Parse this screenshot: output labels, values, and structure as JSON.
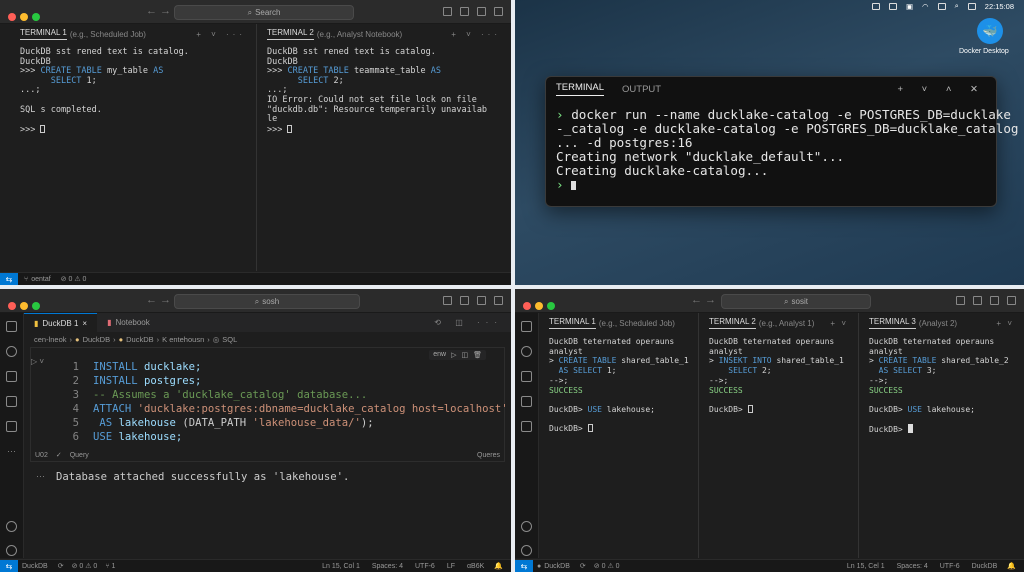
{
  "q1": {
    "search": "Search",
    "pane1": {
      "title": "TERMINAL 1",
      "subtitle": "(e.g., Scheduled Job)",
      "actions": "+ ˅ ···",
      "lines": [
        "DuckDB sst rened text is catalog.",
        "DuckDB"
      ],
      "prompt": ">>> ",
      "kw1": "CREATE TABLE",
      "tbl": " my_table ",
      "kw2": "AS",
      "indent": "      ",
      "kw3": "SELECT",
      "val": " 1;",
      "cont": "...;",
      "done": "SQL s completed.",
      "prompt2": ">>> "
    },
    "pane2": {
      "title": "TERMINAL 2",
      "subtitle": "(e.g., Analyst Notebook)",
      "actions": "+ ˅ ···",
      "lines": [
        "DuckDB sst rened text is catalog.",
        "DuckDB"
      ],
      "prompt": ">>> ",
      "kw1": "CREATE TABLE",
      "tbl": " teammate_table ",
      "kw2": "AS",
      "indent": "      ",
      "kw3": "SELECT",
      "val": " 2;",
      "cont": "...;",
      "err1": "IO Error: Could not set file lock on file",
      "err2": "\"duckdb.db\": Resource temperarily unavailab",
      "err3": "le",
      "prompt2": ">>> "
    },
    "status": {
      "branch": "oentaf",
      "problems": "⊘ 0 ⚠ 0"
    }
  },
  "q2": {
    "clock": "22:15:08",
    "app_label": "Docker Desktop",
    "tab_terminal": "TERMINAL",
    "tab_output": "OUTPUT",
    "actions": "+ ˅ ˄ ✕",
    "prompt": "›",
    "cmd1": "docker run --name ducklake-catalog -e POSTGRES_DB=ducklake",
    "cmd2": "-_catalog -e ducklake-catalog -e POSTGRES_DB=ducklake_catalog",
    "cmd3": "... -d postgres:16",
    "out1": "Creating network \"ducklake_default\"...",
    "out2": "Creating ducklake-catalog..."
  },
  "q3": {
    "search": "sosh",
    "tab_active": "DuckDB 1",
    "tab_other": "Notebook",
    "breadcrumb": [
      "cen-lneok",
      "DuckDB",
      "DuckDB",
      "K entehousn",
      "SQL"
    ],
    "cell_run": "enw",
    "code": {
      "l1a": "INSTALL",
      "l1b": " ducklake;",
      "l2a": "INSTALL",
      "l2b": " postgres;",
      "l3": "-- Assumes a 'ducklake_catalog' database...",
      "l4a": "ATTACH",
      "l4b": " 'ducklake:postgres:dbname=ducklake_catalog host=localhost'",
      "l5a": " AS",
      "l5b": " lakehouse ",
      "l5c": "(DATA_PATH ",
      "l5d": "'lakehouse_data/'",
      "l5e": ");",
      "l6a": "USE",
      "l6b": " lakehouse;"
    },
    "line_numbers": [
      "1",
      "2",
      "3",
      "4",
      "5",
      "6"
    ],
    "cell_footer_left": "U02",
    "cell_footer_query": "Query",
    "cell_footer_right": "Queres",
    "output_dots": "···",
    "output": "Database attached successfully as 'lakehouse'.",
    "status": {
      "branch": "DuckDB",
      "problems": "⊘ 0 ⚠ 0",
      "ports": "⑂ 1",
      "ln": "Ln 15, Col 1",
      "spaces": "Spaces: 4",
      "enc": "UTF-6",
      "eol": "LF",
      "lang": "αB6K"
    }
  },
  "q4": {
    "search": "sosit",
    "panes": [
      {
        "title": "TERMINAL 1",
        "subtitle": "(e.g., Scheduled Job)",
        "h1": "DuckDB teternated operauns",
        "h2": "analyst",
        "kw": "CREATE TABLE",
        "tbl": " shared_table_1",
        "as": "AS",
        "sel": "SELECT",
        "val": " 1;",
        "cont": "-->;",
        "ok": "SUCCESS",
        "p1": "DuckDB> ",
        "use": "USE",
        "uset": " lakehouse;",
        "p2": "DuckDB> "
      },
      {
        "title": "TERMINAL 2",
        "subtitle": "(e.g., Analyst 1)",
        "h1": "DuckDB teternated operauns",
        "h2": "analyst",
        "kw": "INSEKT INTO",
        "tbl": " shared_table_1",
        "as": "",
        "sel": "SELECT",
        "val": " 2;",
        "cont": "-->;",
        "ok": "SUCCESS",
        "p1": "DuckDB> ",
        "use": "",
        "uset": "",
        "p2": ""
      },
      {
        "title": "TERMINAL 3",
        "subtitle": "(Analyst 2)",
        "h1": "DuckDB teternated operauns",
        "h2": "analyst",
        "kw": "CREATE TABLE",
        "tbl": " shared_table_2",
        "as": "AS",
        "sel": "SELECT",
        "val": " 3;",
        "cont": "-->;",
        "ok": "SUCCESS",
        "p1": "DuckDB> ",
        "use": "USE",
        "uset": " lakehouse;",
        "p2": "DuckDB> "
      }
    ],
    "status": {
      "branch": "DuckDB",
      "problems": "⊘ 0 ⚠ 0",
      "ln": "Ln 15, Cel 1",
      "spaces": "Spaces: 4",
      "enc": "UTF-6",
      "lang": "DuckDB"
    }
  },
  "colors": {
    "accent": "#0078d4",
    "keyword": "#569cd6",
    "success": "#89d185",
    "string": "#ce9178",
    "comment": "#6a9955"
  }
}
